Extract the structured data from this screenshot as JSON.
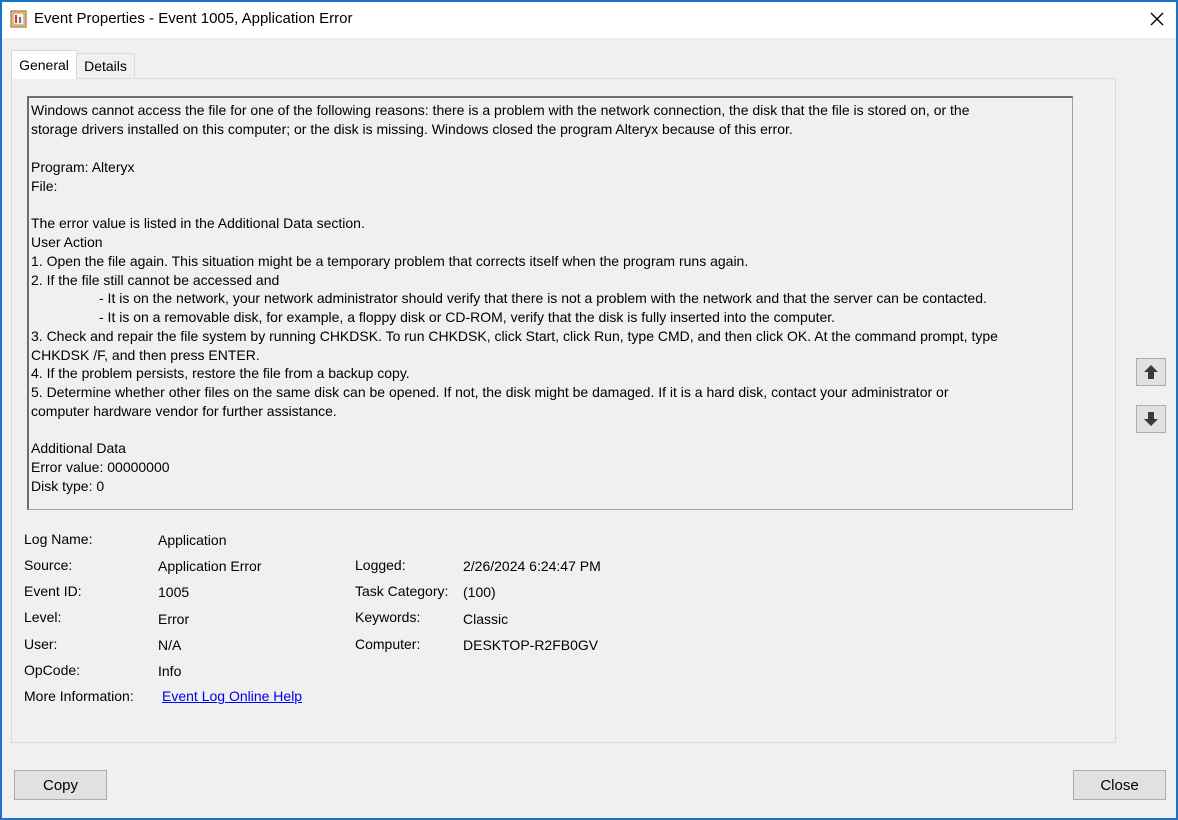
{
  "window": {
    "title": "Event Properties - Event 1005, Application Error"
  },
  "tabs": [
    {
      "label": "General",
      "selected": true
    },
    {
      "label": "Details",
      "selected": false
    }
  ],
  "description": {
    "lines": [
      "Windows cannot access the file  for one of the following reasons: there is a problem with the network connection, the disk that the file is stored on, or the",
      "storage drivers installed on this computer; or the disk is missing. Windows closed the program Alteryx because of this error.",
      "",
      "Program: Alteryx",
      "File:",
      "",
      "The error value is listed in the Additional Data section.",
      "User Action",
      "1. Open the file again. This situation might be a temporary problem that corrects itself when the program runs again.",
      "2. If the file still cannot be accessed and",
      "- It is on the network, your network administrator should verify that there is not a problem with the network and that the server can be contacted.",
      "- It is on a removable disk, for example, a floppy disk or CD-ROM, verify that the disk is fully inserted into the computer.",
      "3. Check and repair the file system by running CHKDSK. To run CHKDSK, click Start, click Run, type CMD, and then click OK. At the command prompt, type",
      "CHKDSK /F, and then press ENTER.",
      "4. If the problem persists, restore the file from a backup copy.",
      "5. Determine whether other files on the same disk can be opened. If not, the disk might be damaged. If it is a hard disk, contact your administrator or",
      "computer hardware vendor for further assistance.",
      "",
      "Additional Data",
      "Error value: 00000000",
      "Disk type: 0"
    ]
  },
  "properties": {
    "log_name_label": "Log Name:",
    "log_name_value": "Application",
    "source_label": "Source:",
    "source_value": "Application Error",
    "event_id_label": "Event ID:",
    "event_id_value": "1005",
    "level_label": "Level:",
    "level_value": "Error",
    "user_label": "User:",
    "user_value": "N/A",
    "opcode_label": "OpCode:",
    "opcode_value": "Info",
    "more_info_label": "More Information:",
    "more_info_link": "Event Log Online Help",
    "logged_label": "Logged:",
    "logged_value": "2/26/2024 6:24:47 PM",
    "task_category_label": "Task Category:",
    "task_category_value": "(100)",
    "keywords_label": "Keywords:",
    "keywords_value": "Classic",
    "computer_label": "Computer:",
    "computer_value": "DESKTOP-R2FB0GV"
  },
  "buttons": {
    "copy": "Copy",
    "close": "Close"
  },
  "icons": {
    "app": "event-viewer-icon",
    "close": "close-icon",
    "up": "arrow-up-icon",
    "down": "arrow-down-icon"
  }
}
